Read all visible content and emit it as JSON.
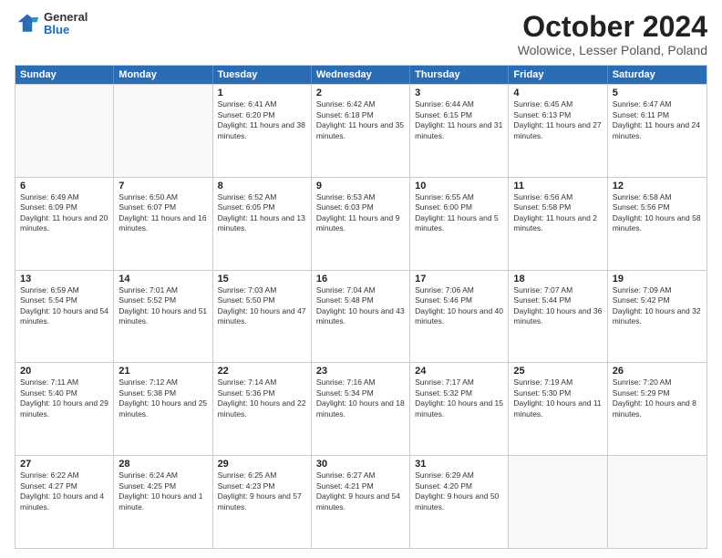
{
  "header": {
    "logo_general": "General",
    "logo_blue": "Blue",
    "month": "October 2024",
    "location": "Wolowice, Lesser Poland, Poland"
  },
  "days_of_week": [
    "Sunday",
    "Monday",
    "Tuesday",
    "Wednesday",
    "Thursday",
    "Friday",
    "Saturday"
  ],
  "weeks": [
    [
      {
        "day": "",
        "info": ""
      },
      {
        "day": "",
        "info": ""
      },
      {
        "day": "1",
        "info": "Sunrise: 6:41 AM\nSunset: 6:20 PM\nDaylight: 11 hours and 38 minutes."
      },
      {
        "day": "2",
        "info": "Sunrise: 6:42 AM\nSunset: 6:18 PM\nDaylight: 11 hours and 35 minutes."
      },
      {
        "day": "3",
        "info": "Sunrise: 6:44 AM\nSunset: 6:15 PM\nDaylight: 11 hours and 31 minutes."
      },
      {
        "day": "4",
        "info": "Sunrise: 6:45 AM\nSunset: 6:13 PM\nDaylight: 11 hours and 27 minutes."
      },
      {
        "day": "5",
        "info": "Sunrise: 6:47 AM\nSunset: 6:11 PM\nDaylight: 11 hours and 24 minutes."
      }
    ],
    [
      {
        "day": "6",
        "info": "Sunrise: 6:49 AM\nSunset: 6:09 PM\nDaylight: 11 hours and 20 minutes."
      },
      {
        "day": "7",
        "info": "Sunrise: 6:50 AM\nSunset: 6:07 PM\nDaylight: 11 hours and 16 minutes."
      },
      {
        "day": "8",
        "info": "Sunrise: 6:52 AM\nSunset: 6:05 PM\nDaylight: 11 hours and 13 minutes."
      },
      {
        "day": "9",
        "info": "Sunrise: 6:53 AM\nSunset: 6:03 PM\nDaylight: 11 hours and 9 minutes."
      },
      {
        "day": "10",
        "info": "Sunrise: 6:55 AM\nSunset: 6:00 PM\nDaylight: 11 hours and 5 minutes."
      },
      {
        "day": "11",
        "info": "Sunrise: 6:56 AM\nSunset: 5:58 PM\nDaylight: 11 hours and 2 minutes."
      },
      {
        "day": "12",
        "info": "Sunrise: 6:58 AM\nSunset: 5:56 PM\nDaylight: 10 hours and 58 minutes."
      }
    ],
    [
      {
        "day": "13",
        "info": "Sunrise: 6:59 AM\nSunset: 5:54 PM\nDaylight: 10 hours and 54 minutes."
      },
      {
        "day": "14",
        "info": "Sunrise: 7:01 AM\nSunset: 5:52 PM\nDaylight: 10 hours and 51 minutes."
      },
      {
        "day": "15",
        "info": "Sunrise: 7:03 AM\nSunset: 5:50 PM\nDaylight: 10 hours and 47 minutes."
      },
      {
        "day": "16",
        "info": "Sunrise: 7:04 AM\nSunset: 5:48 PM\nDaylight: 10 hours and 43 minutes."
      },
      {
        "day": "17",
        "info": "Sunrise: 7:06 AM\nSunset: 5:46 PM\nDaylight: 10 hours and 40 minutes."
      },
      {
        "day": "18",
        "info": "Sunrise: 7:07 AM\nSunset: 5:44 PM\nDaylight: 10 hours and 36 minutes."
      },
      {
        "day": "19",
        "info": "Sunrise: 7:09 AM\nSunset: 5:42 PM\nDaylight: 10 hours and 32 minutes."
      }
    ],
    [
      {
        "day": "20",
        "info": "Sunrise: 7:11 AM\nSunset: 5:40 PM\nDaylight: 10 hours and 29 minutes."
      },
      {
        "day": "21",
        "info": "Sunrise: 7:12 AM\nSunset: 5:38 PM\nDaylight: 10 hours and 25 minutes."
      },
      {
        "day": "22",
        "info": "Sunrise: 7:14 AM\nSunset: 5:36 PM\nDaylight: 10 hours and 22 minutes."
      },
      {
        "day": "23",
        "info": "Sunrise: 7:16 AM\nSunset: 5:34 PM\nDaylight: 10 hours and 18 minutes."
      },
      {
        "day": "24",
        "info": "Sunrise: 7:17 AM\nSunset: 5:32 PM\nDaylight: 10 hours and 15 minutes."
      },
      {
        "day": "25",
        "info": "Sunrise: 7:19 AM\nSunset: 5:30 PM\nDaylight: 10 hours and 11 minutes."
      },
      {
        "day": "26",
        "info": "Sunrise: 7:20 AM\nSunset: 5:29 PM\nDaylight: 10 hours and 8 minutes."
      }
    ],
    [
      {
        "day": "27",
        "info": "Sunrise: 6:22 AM\nSunset: 4:27 PM\nDaylight: 10 hours and 4 minutes."
      },
      {
        "day": "28",
        "info": "Sunrise: 6:24 AM\nSunset: 4:25 PM\nDaylight: 10 hours and 1 minute."
      },
      {
        "day": "29",
        "info": "Sunrise: 6:25 AM\nSunset: 4:23 PM\nDaylight: 9 hours and 57 minutes."
      },
      {
        "day": "30",
        "info": "Sunrise: 6:27 AM\nSunset: 4:21 PM\nDaylight: 9 hours and 54 minutes."
      },
      {
        "day": "31",
        "info": "Sunrise: 6:29 AM\nSunset: 4:20 PM\nDaylight: 9 hours and 50 minutes."
      },
      {
        "day": "",
        "info": ""
      },
      {
        "day": "",
        "info": ""
      }
    ]
  ]
}
